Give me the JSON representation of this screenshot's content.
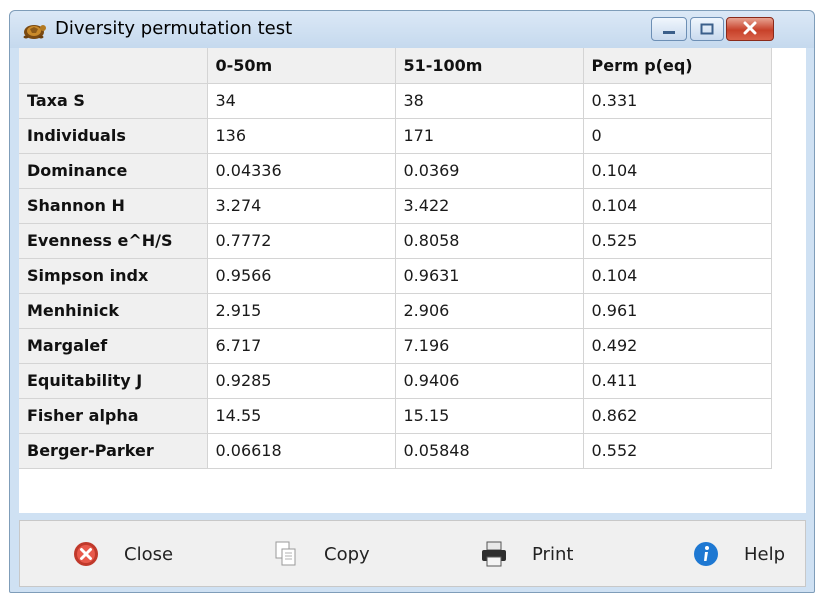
{
  "window": {
    "title": "Diversity permutation test"
  },
  "table": {
    "columns": [
      "",
      "0-50m",
      "51-100m",
      "Perm p(eq)"
    ],
    "rows": [
      {
        "label": "Taxa S",
        "values": [
          "34",
          "38",
          "0.331"
        ]
      },
      {
        "label": "Individuals",
        "values": [
          "136",
          "171",
          "0"
        ]
      },
      {
        "label": "Dominance",
        "values": [
          "0.04336",
          "0.0369",
          "0.104"
        ]
      },
      {
        "label": "Shannon H",
        "values": [
          "3.274",
          "3.422",
          "0.104"
        ]
      },
      {
        "label": "Evenness e^H/S",
        "values": [
          "0.7772",
          "0.8058",
          "0.525"
        ]
      },
      {
        "label": "Simpson indx",
        "values": [
          "0.9566",
          "0.9631",
          "0.104"
        ]
      },
      {
        "label": "Menhinick",
        "values": [
          "2.915",
          "2.906",
          "0.961"
        ]
      },
      {
        "label": "Margalef",
        "values": [
          "6.717",
          "7.196",
          "0.492"
        ]
      },
      {
        "label": "Equitability J",
        "values": [
          "0.9285",
          "0.9406",
          "0.411"
        ]
      },
      {
        "label": "Fisher alpha",
        "values": [
          "14.55",
          "15.15",
          "0.862"
        ]
      },
      {
        "label": "Berger-Parker",
        "values": [
          "0.06618",
          "0.05848",
          "0.552"
        ]
      }
    ]
  },
  "footer": {
    "close_label": "Close",
    "copy_label": "Copy",
    "print_label": "Print",
    "help_label": "Help"
  },
  "icons": {
    "app": "turtle-icon",
    "close": "close-circle-icon",
    "copy": "copy-icon",
    "print": "printer-icon",
    "help": "info-icon"
  },
  "colors": {
    "title_bar": "#c5d9ee",
    "close_button": "#c7412a",
    "header_bg": "#f0f0f0",
    "help_icon": "#1e78d2"
  }
}
